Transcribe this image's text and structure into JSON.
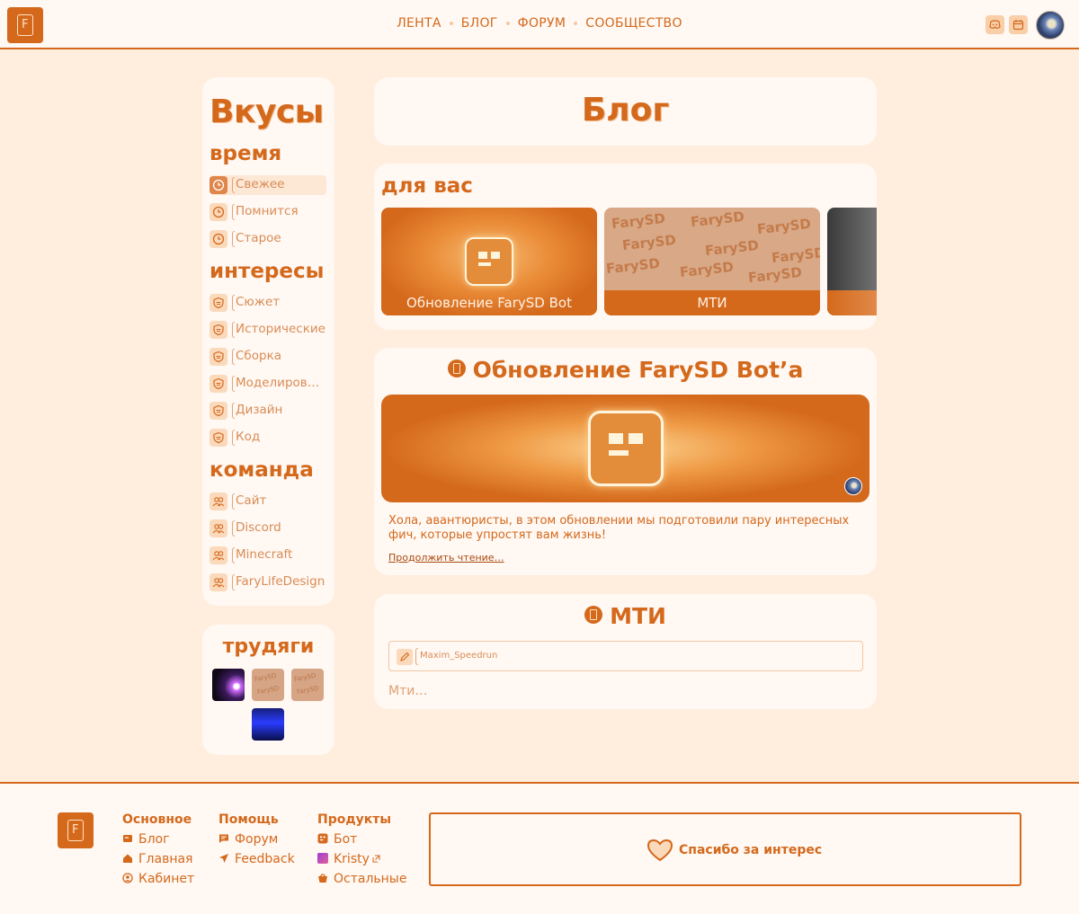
{
  "header": {
    "nav": [
      "ЛЕНТА",
      "БЛОГ",
      "ФОРУМ",
      "СООБЩЕСТВО"
    ]
  },
  "sidebar": {
    "title": "Вкусы",
    "sections": [
      {
        "heading": "время",
        "icon": "clock-icon",
        "items": [
          "Свежее",
          "Помнится",
          "Старое"
        ],
        "active": "Свежее"
      },
      {
        "heading": "интересы",
        "icon": "shield-icon",
        "items": [
          "Сюжет",
          "Исторические",
          "Сборка",
          "Моделиров…",
          "Дизайн",
          "Код"
        ]
      },
      {
        "heading": "команда",
        "icon": "users-icon",
        "items": [
          "Сайт",
          "Discord",
          "Minecraft",
          "FaryLifeDesign"
        ]
      }
    ]
  },
  "workers": {
    "title": "трудяги"
  },
  "main": {
    "page_title": "Блог",
    "for_you": {
      "title": "для вас",
      "tiles": [
        "Обновление FarySD Bot",
        "МТИ"
      ]
    },
    "posts": [
      {
        "title": "Обновление FarySD Bot’a",
        "excerpt": "Хола, авантюристы, в этом обновлении мы подготовили пару интересных фич, которые упростят вам жизнь!",
        "readmore": "Продолжить чтение…"
      },
      {
        "title": "МТИ",
        "author": "Maxim_Speedrun",
        "text": "Мти…"
      }
    ]
  },
  "footer": {
    "columns": [
      {
        "heading": "Основное",
        "links": [
          "Блог",
          "Главная",
          "Кабинет"
        ]
      },
      {
        "heading": "Помощь",
        "links": [
          "Форум",
          "Feedback"
        ]
      },
      {
        "heading": "Продукты",
        "links": [
          "Бот",
          "Kristy",
          "Остальные"
        ]
      }
    ],
    "thanks": "Спасибо за интерес"
  },
  "colors": {
    "accent": "#d4691c",
    "background": "#ffeedd",
    "card": "#fff8f3"
  }
}
